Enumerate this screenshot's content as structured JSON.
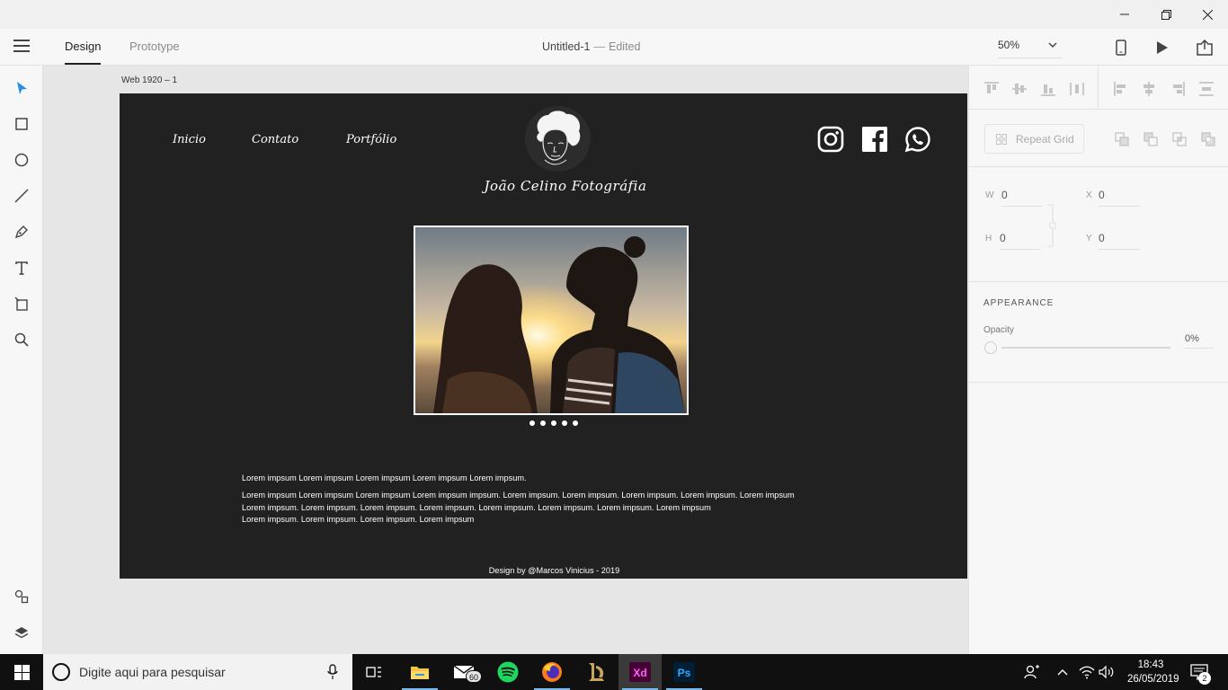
{
  "window": {
    "controls": [
      "minimize",
      "restore",
      "close"
    ]
  },
  "header": {
    "tabs": [
      {
        "label": "Design",
        "active": true
      },
      {
        "label": "Prototype",
        "active": false
      }
    ],
    "document_title": "Untitled-1",
    "separator": "—",
    "document_status": "Edited",
    "zoom": "50%"
  },
  "toolbar": {
    "tools": [
      "select-tool",
      "rectangle-tool",
      "ellipse-tool",
      "line-tool",
      "pen-tool",
      "text-tool",
      "artboard-tool",
      "zoom-tool"
    ],
    "bottom": [
      "assets-panel",
      "layers-panel"
    ]
  },
  "canvas": {
    "artboard_label": "Web 1920 – 1",
    "site": {
      "nav": [
        "Inicio",
        "Contato",
        "Portfólio"
      ],
      "brand": "João Celino Fotográfia",
      "social": [
        "instagram",
        "facebook",
        "whatsapp"
      ],
      "carousel_dots": 5,
      "lorem_line1": "Lorem impsum Lorem impsum Lorem impsum Lorem impsum Lorem impsum.",
      "lorem_para": [
        "Lorem impsum Lorem impsum Lorem impsum Lorem impsum impsum. Lorem impsum. Lorem impsum. Lorem impsum. Lorem impsum. Lorem impsum",
        "Lorem impsum. Lorem impsum. Lorem impsum. Lorem impsum. Lorem impsum. Lorem impsum. Lorem impsum. Lorem impsum",
        "Lorem impsum. Lorem impsum. Lorem impsum. Lorem impsum"
      ],
      "footer": "Design by @Marcos Vinicius - 2019"
    }
  },
  "properties": {
    "repeat_grid": "Repeat Grid",
    "w_label": "W",
    "w_value": "0",
    "h_label": "H",
    "h_value": "0",
    "x_label": "X",
    "x_value": "0",
    "y_label": "Y",
    "y_value": "0",
    "appearance": "APPEARANCE",
    "opacity_label": "Opacity",
    "opacity_value": "0%"
  },
  "taskbar": {
    "search_placeholder": "Digite aqui para pesquisar",
    "mail_badge": "60",
    "apps": [
      "task-view",
      "file-explorer",
      "mail",
      "spotify",
      "firefox",
      "league-of-legends",
      "adobe-xd",
      "photoshop"
    ],
    "xd_label": "Xd",
    "ps_label": "Ps",
    "time": "18:43",
    "date": "26/05/2019",
    "notification_count": "2"
  },
  "colors": {
    "accent_blue": "#2c8de2",
    "artboard_bg": "#212121",
    "xd_pink": "#ff2bc2",
    "ps_blue": "#31a8ff"
  }
}
